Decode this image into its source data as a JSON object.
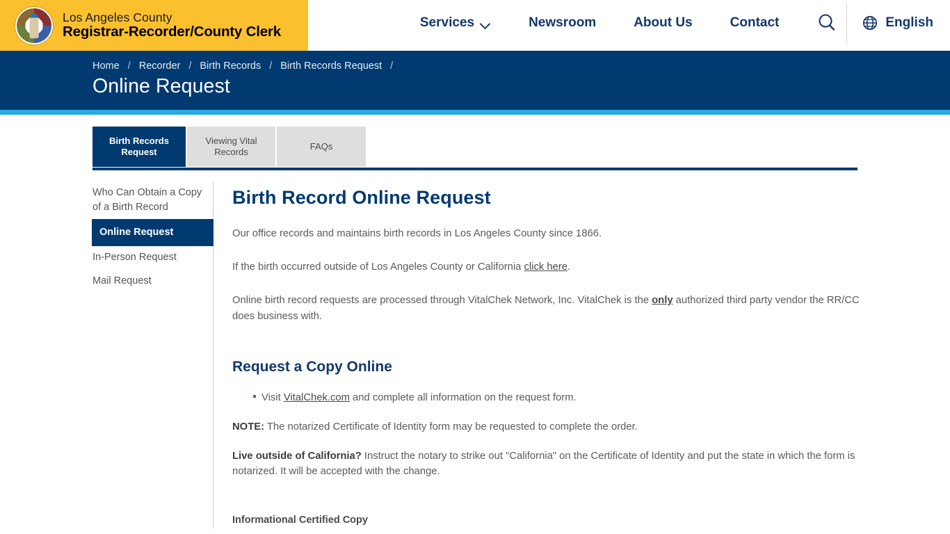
{
  "header": {
    "brand": {
      "seal_icon": "county-seal-icon",
      "line1": "Los Angeles County",
      "line2": "Registrar-Recorder/County Clerk"
    },
    "nav": [
      {
        "label": "Services",
        "has_dropdown": true
      },
      {
        "label": "Newsroom",
        "has_dropdown": false
      },
      {
        "label": "About Us",
        "has_dropdown": false
      },
      {
        "label": "Contact",
        "has_dropdown": false
      }
    ],
    "search_icon": "search-icon",
    "language": {
      "icon": "globe-icon",
      "label": "English"
    }
  },
  "banner": {
    "breadcrumbs": [
      "Home",
      "Recorder",
      "Birth Records",
      "Birth Records Request"
    ],
    "separator": "/",
    "title": "Online Request"
  },
  "tabs": [
    {
      "label": "Birth Records Request",
      "active": true
    },
    {
      "label": "Viewing Vital Records",
      "active": false
    },
    {
      "label": "FAQs",
      "active": false
    }
  ],
  "sidebar": {
    "items": [
      {
        "label": "Who Can Obtain a Copy of a Birth Record",
        "active": false
      },
      {
        "label": "Online Request",
        "active": true
      },
      {
        "label": "In-Person Request",
        "active": false
      },
      {
        "label": "Mail Request",
        "active": false
      }
    ]
  },
  "main": {
    "heading": "Birth Record Online Request",
    "para1": "Our office records and maintains birth records in Los Angeles County since 1866.",
    "para2_before": "If the birth occurred outside of Los Angeles County or California ",
    "para2_link": "click here",
    "para2_after": ".",
    "para3_before": "Online birth record requests are processed through VitalChek Network, Inc. VitalChek is the ",
    "para3_emphasis": "only",
    "para3_after": " authorized third party vendor the RR/CC does business with.",
    "subheading": "Request a Copy Online",
    "bullet1_before": "Visit ",
    "bullet1_link": "VitalChek.com",
    "bullet1_after": " and complete all information on the request form.",
    "note_label": "NOTE:",
    "note_text": " The notarized Certificate of Identity form may be requested to complete the order.",
    "outside_label": "Live outside of California?",
    "outside_text": " Instruct the notary to strike out \"California\" on the Certificate of Identity and put the state in which the form is notarized. It will be accepted with the change.",
    "informational_copy": "Informational Certified Copy"
  },
  "colors": {
    "brand_yellow": "#fbc02d",
    "navy": "#003a70",
    "cyan": "#29abe2",
    "nav_text": "#13386b",
    "body_text": "#5a5a5a"
  }
}
